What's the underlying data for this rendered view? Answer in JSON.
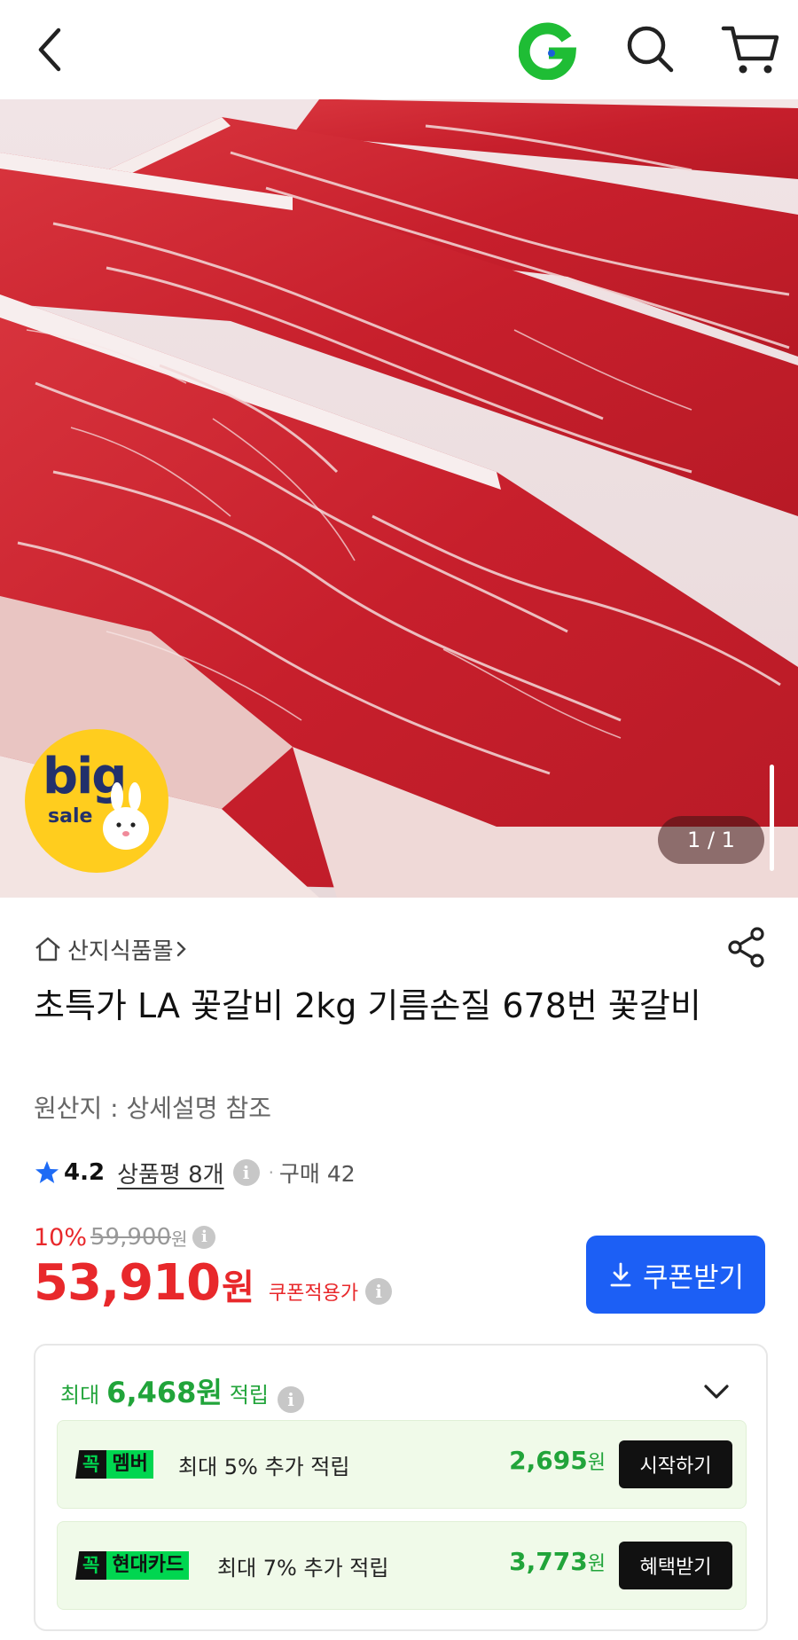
{
  "header": {
    "back_icon": "chevron-left-icon",
    "logo_icon": "g-logo-icon",
    "search_icon": "search-icon",
    "cart_icon": "cart-icon"
  },
  "hero": {
    "badge_big": "big",
    "badge_sale": "sale",
    "pager": "1 / 1"
  },
  "shop": {
    "name": "산지식품몰"
  },
  "product": {
    "title": "초특가 LA 꽃갈비 2kg 기름손질 678번 꽃갈비",
    "origin": "원산지 : 상세설명 참조",
    "rating": "4.2",
    "reviews": "상품평 8개",
    "purchase": "구매 42"
  },
  "price": {
    "discount": "10%",
    "original": "59,900",
    "original_unit": "원",
    "sale": "53,910",
    "sale_unit": "원",
    "coupon_note": "쿠폰적용가",
    "coupon_button": "쿠폰받기"
  },
  "benefit": {
    "max_label": "최대",
    "max_amount": "6,468원",
    "accrue_label": "적립",
    "rows": [
      {
        "tag_prefix": "꼭",
        "tag_label": "멤버",
        "desc": "최대 5% 추가 적립",
        "amount": "2,695",
        "unit": "원",
        "button": "시작하기"
      },
      {
        "tag_prefix": "꼭",
        "tag_label": "현대카드",
        "desc": "최대 7% 추가 적립",
        "amount": "3,773",
        "unit": "원",
        "button": "혜택받기"
      }
    ]
  },
  "colors": {
    "accent_red": "#e8282b",
    "accent_blue": "#1c5ff5",
    "accent_green": "#21a43a",
    "logo_green": "#1fbd35"
  }
}
